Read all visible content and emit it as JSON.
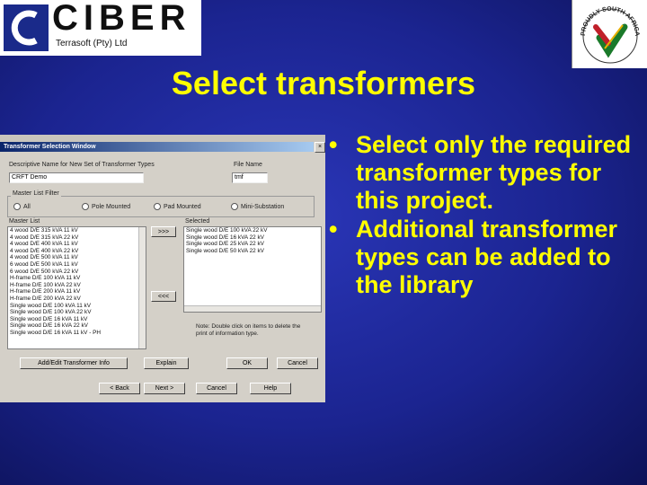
{
  "logo_left": {
    "brand": "CIBER",
    "sub": "Terrasoft (Pty) Ltd"
  },
  "logo_right": {
    "text": "PROUDLY SOUTH AFRICAN"
  },
  "title": "Select transformers",
  "bullets": [
    {
      "dot": "•",
      "text": "Select only the required transformer types for this project."
    },
    {
      "dot": "•",
      "text": "Additional transformer types can be added to the library"
    }
  ],
  "dialog": {
    "window_title": "Transformer Selection Window",
    "close_glyph": "×",
    "desc_label": "Descriptive Name for New Set of Transformer Types",
    "desc_value": "CRFT Demo",
    "file_label": "File Name",
    "file_value": "tmf",
    "filter_label": "Master List Filter",
    "filter_options": [
      "All",
      "Pole Mounted",
      "Pad Mounted",
      "Mini-Substation"
    ],
    "master_label": "Master List",
    "master_items": [
      "4 wood D/E 315 kVA 11 kV",
      "4 wood D/E 315 kVA 22 kV",
      "4 wood D/E 400 kVA 11 kV",
      "4 wood D/E 400 kVA 22 kV",
      "4 wood D/E 500 kVA 11 kV",
      "6 wood D/E 500 kVA 11 kV",
      "6 wood D/E 500 kVA 22 kV",
      "H-frame D/E 100 kVA 11 kV",
      "H-frame D/E 100 kVA 22 kV",
      "H-frame D/E 200 kVA 11 kV",
      "H-frame D/E 200 kVA 22 kV",
      "Single wood D/E 100 kVA 11 kV",
      "Single wood D/E 100 kVA 22 kV",
      "Single wood D/E 16 kVA 11 kV",
      "Single wood D/E 16 kVA 22 kV",
      "Single wood D/E 16 kVA 11 kV - PH"
    ],
    "selected_label": "Selected",
    "selected_items": [
      "Single wood D/E 100 kVA 22 kV",
      "Single wood D/E 16 kVA 22 kV",
      "Single wood D/E 25 kVA 22 kV",
      "Single wood D/E 50 kVA 22 kV"
    ],
    "add_btn": ">>>",
    "remove_btn": "<<<",
    "note": "Note: Double click on items to delete the print of information type.",
    "btn_add_info": "Add/Edit Transformer Info",
    "btn_explain": "Explain",
    "btn_ok": "OK",
    "btn_cancel": "Cancel",
    "btn_back": "< Back",
    "btn_next": "Next >",
    "btn_cancel2": "Cancel",
    "btn_help": "Help"
  }
}
